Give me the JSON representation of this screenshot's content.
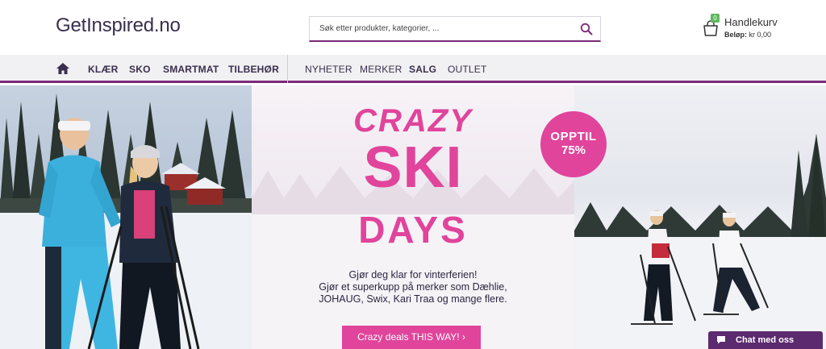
{
  "header": {
    "logo": "GetInspired.no",
    "search": {
      "placeholder": "Søk etter produkter, kategorier, ..."
    },
    "cart": {
      "badge_count": "0",
      "title": "Handlekurv",
      "amount_label": "Beløp:",
      "amount_value": "kr 0,00"
    }
  },
  "nav": {
    "primary": [
      "KLÆR",
      "SKO",
      "SMARTMAT",
      "TILBEHØR"
    ],
    "secondary": [
      "NYHETER",
      "MERKER",
      "SALG",
      "OUTLET"
    ]
  },
  "banner": {
    "line1": "CRAZY",
    "line2": "SKI",
    "line3": "DAYS",
    "badge_line1": "OPPTIL",
    "badge_line2": "75%",
    "tagline_1": "Gjør deg klar for vinterferien!",
    "tagline_2": "Gjør et superkupp på merker som Dæhlie,",
    "tagline_3": "JOHAUG, Swix, Kari Traa og mange flere.",
    "cta": "Crazy deals THIS WAY! ›"
  },
  "chat": {
    "label": "Chat med oss"
  },
  "colors": {
    "brand": "#7b2a7a",
    "accent_pink": "#e0449b",
    "chat_bg": "#5c2a6e",
    "cart_badge": "#5cb85c"
  },
  "icons": [
    "search-icon",
    "cart-icon",
    "home-icon",
    "chat-bubble-icon"
  ]
}
